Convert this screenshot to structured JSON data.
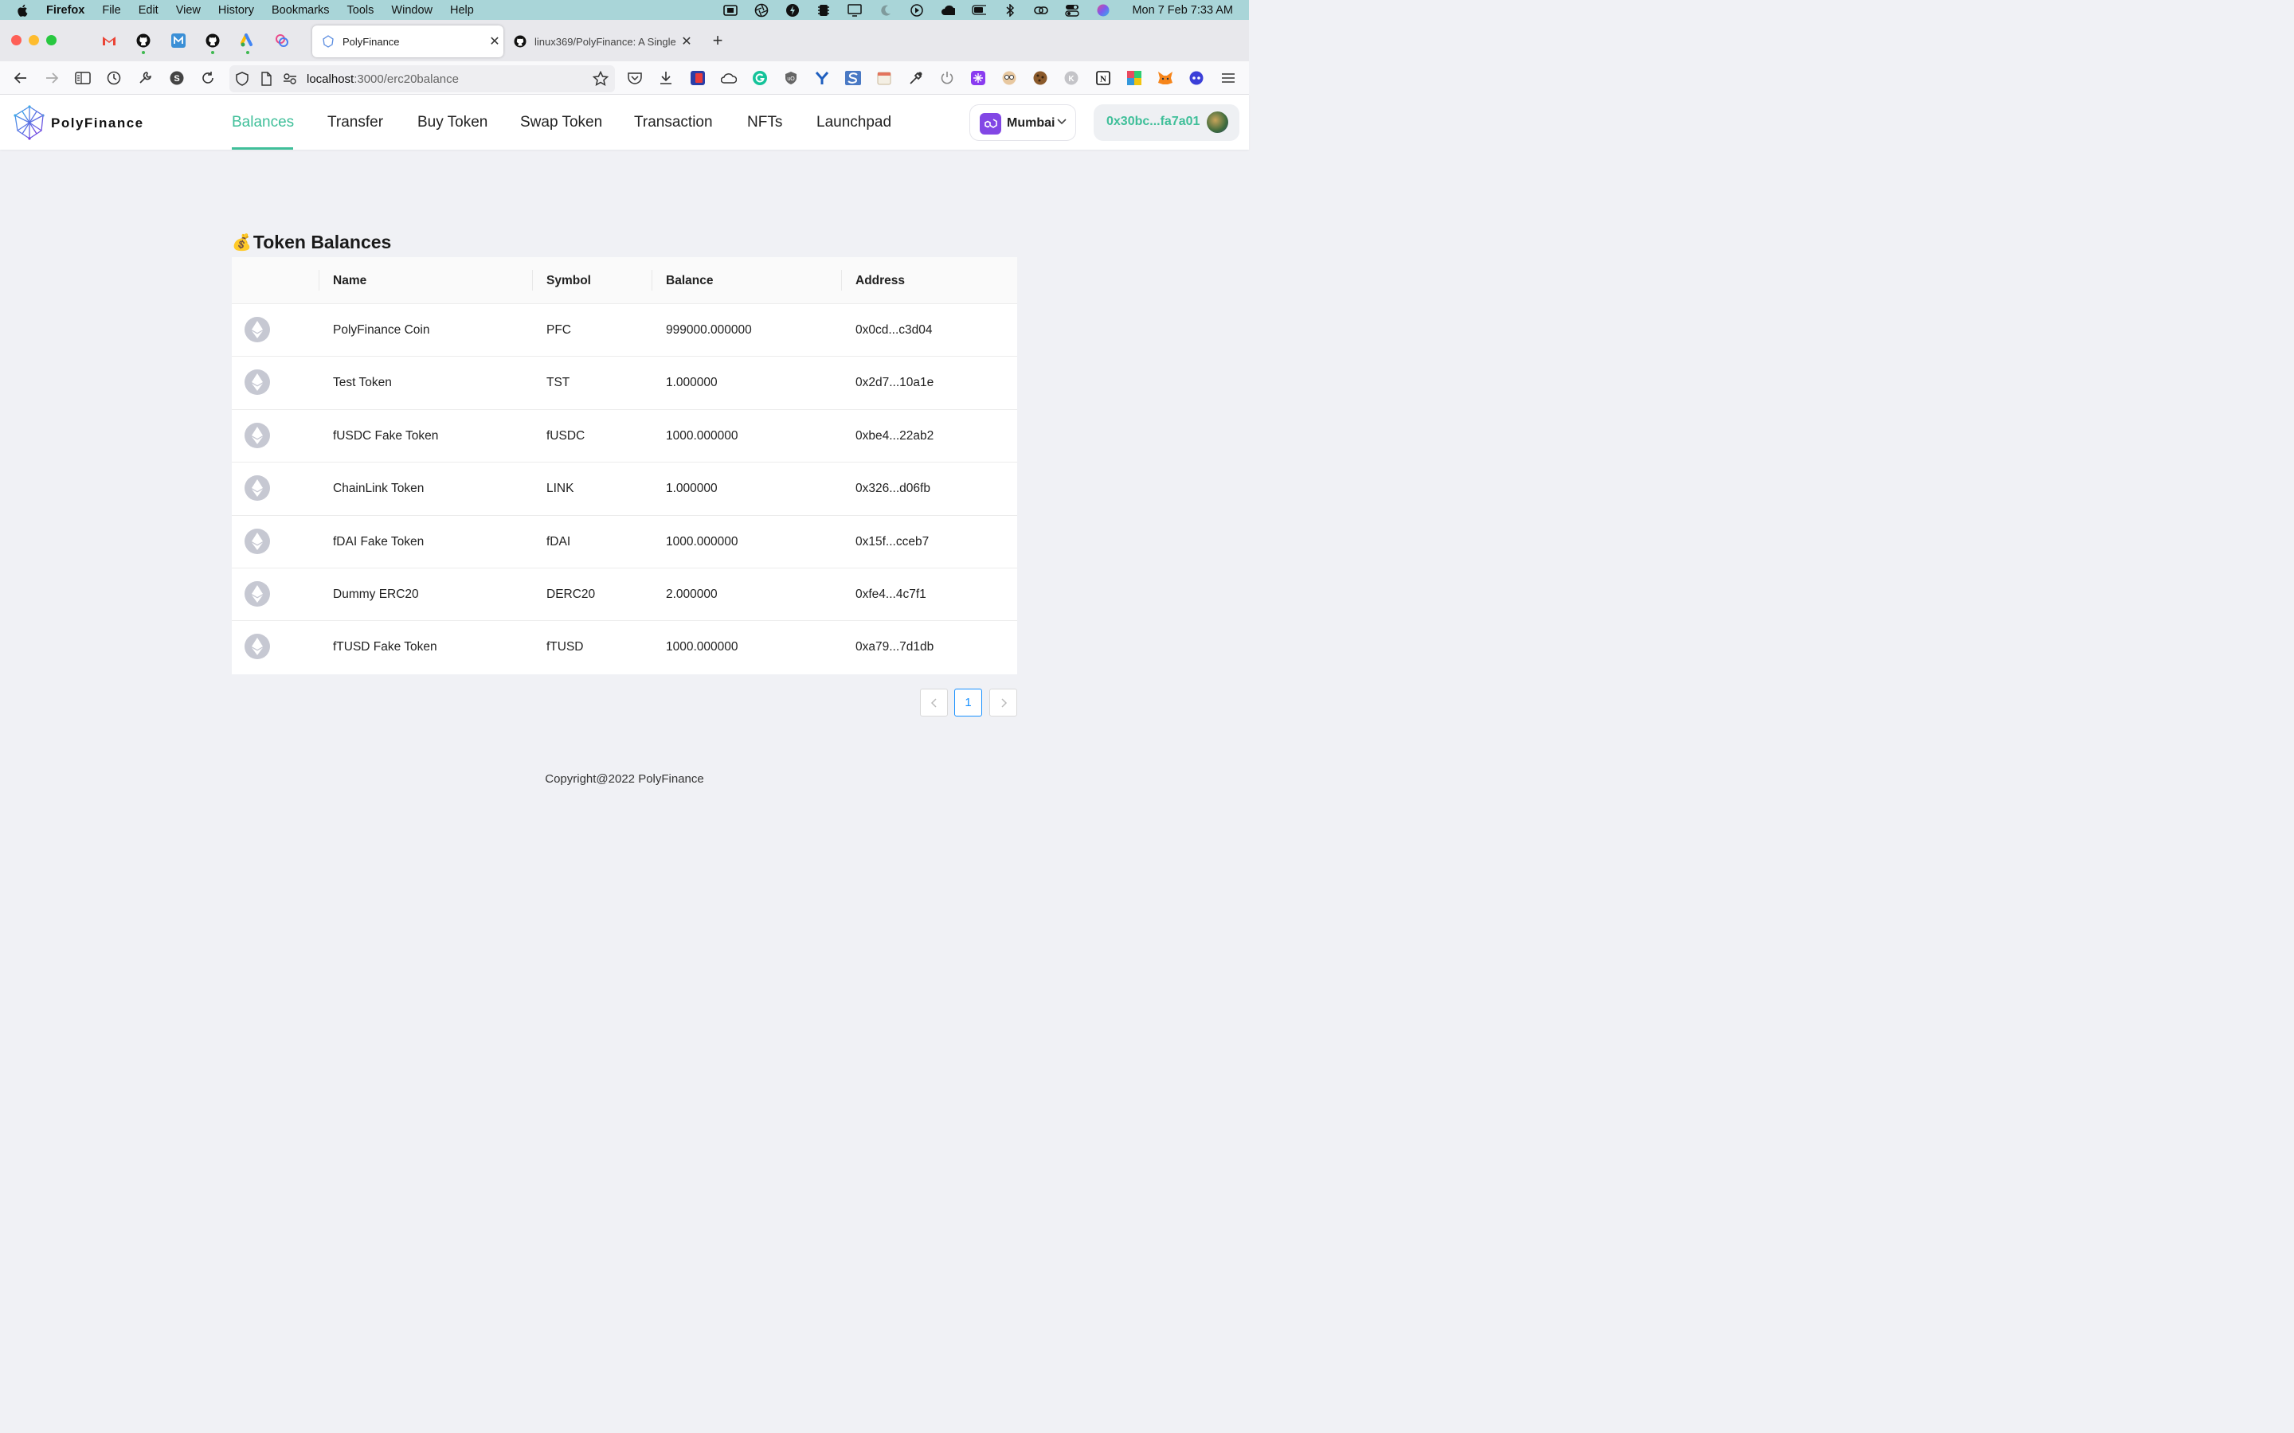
{
  "menubar": {
    "app": "Firefox",
    "items": [
      "File",
      "Edit",
      "View",
      "History",
      "Bookmarks",
      "Tools",
      "Window",
      "Help"
    ],
    "clock": "Mon 7 Feb  7:33 AM"
  },
  "tabs": [
    {
      "title": "PolyFinance",
      "active": true
    },
    {
      "title": "linux369/PolyFinance: A Single D",
      "active": false
    }
  ],
  "url": {
    "host": "localhost",
    "path": ":3000/erc20balance"
  },
  "app": {
    "brand": "PolyFinance",
    "nav": [
      "Balances",
      "Transfer",
      "Buy Token",
      "Swap Token",
      "Transaction",
      "NFTs",
      "Launchpad"
    ],
    "network": "Mumbai",
    "account": "0x30bc...fa7a01"
  },
  "page": {
    "title": "Token Balances",
    "columns": [
      "Name",
      "Symbol",
      "Balance",
      "Address"
    ],
    "rows": [
      {
        "name": "PolyFinance Coin",
        "symbol": "PFC",
        "balance": "999000.000000",
        "address": "0x0cd...c3d04"
      },
      {
        "name": "Test Token",
        "symbol": "TST",
        "balance": "1.000000",
        "address": "0x2d7...10a1e"
      },
      {
        "name": "fUSDC Fake Token",
        "symbol": "fUSDC",
        "balance": "1000.000000",
        "address": "0xbe4...22ab2"
      },
      {
        "name": "ChainLink Token",
        "symbol": "LINK",
        "balance": "1.000000",
        "address": "0x326...d06fb"
      },
      {
        "name": "fDAI Fake Token",
        "symbol": "fDAI",
        "balance": "1000.000000",
        "address": "0x15f...cceb7"
      },
      {
        "name": "Dummy ERC20",
        "symbol": "DERC20",
        "balance": "2.000000",
        "address": "0xfe4...4c7f1"
      },
      {
        "name": "fTUSD Fake Token",
        "symbol": "fTUSD",
        "balance": "1000.000000",
        "address": "0xa79...7d1db"
      }
    ],
    "pagination": {
      "current": "1"
    }
  },
  "footer": "Copyright@2022 PolyFinance",
  "colors": {
    "accent": "#3fbf99",
    "polygon": "#8247e5",
    "pagination": "#1890ff"
  }
}
